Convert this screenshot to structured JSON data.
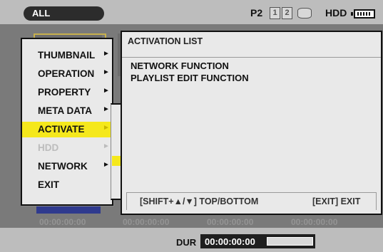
{
  "topbar": {
    "filter_label": "ALL",
    "p2_label": "P2",
    "slots": [
      "1",
      "2"
    ],
    "hdd_label": "HDD",
    "icons": [
      "hdd-icon",
      "battery-icon"
    ]
  },
  "background": {
    "timecodes": [
      "00:00:00:00",
      "00:00:00:00",
      "00:00:00:00",
      "00:00:00:00"
    ]
  },
  "menu": {
    "items": [
      {
        "label": "THUMBNAIL",
        "arrow": "►",
        "state": "normal"
      },
      {
        "label": "OPERATION",
        "arrow": "►",
        "state": "normal"
      },
      {
        "label": "PROPERTY",
        "arrow": "►",
        "state": "normal"
      },
      {
        "label": "META DATA",
        "arrow": "►",
        "state": "normal"
      },
      {
        "label": "ACTIVATE",
        "arrow": "►",
        "state": "selected"
      },
      {
        "label": "HDD",
        "arrow": "►",
        "state": "disabled"
      },
      {
        "label": "NETWORK",
        "arrow": "►",
        "state": "normal"
      },
      {
        "label": "EXIT",
        "arrow": "",
        "state": "normal"
      }
    ]
  },
  "activation_panel": {
    "title": "ACTIVATION LIST",
    "items": [
      "NETWORK FUNCTION",
      "PLAYLIST EDIT FUNCTION"
    ],
    "footer_left": "[SHIFT+▲/▼] TOP/BOTTOM",
    "footer_right": "[EXIT] EXIT"
  },
  "bottombar": {
    "dur_label": "DUR",
    "dur_value": "00:00:00:00"
  },
  "colors": {
    "highlight": "#f5e81c",
    "menu_bg": "#e9e9e9",
    "status_bg": "#bdbdbd"
  }
}
